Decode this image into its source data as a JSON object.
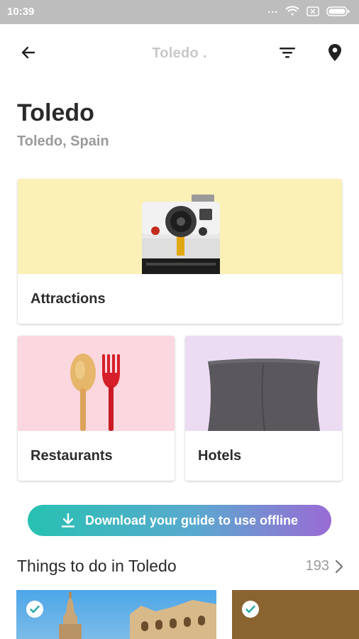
{
  "status_bar": {
    "time": "10:39",
    "dots": "..."
  },
  "header": {
    "title": "Toledo ."
  },
  "city": {
    "title": "Toledo",
    "subtitle": "Toledo, Spain"
  },
  "categories": [
    {
      "label": "Attractions"
    },
    {
      "label": "Restaurants"
    },
    {
      "label": "Hotels"
    }
  ],
  "download": {
    "label": "Download your guide to use offline"
  },
  "things_to_do": {
    "title": "Things to do in Toledo",
    "count": "193"
  },
  "colors": {
    "attractions_bg": "#fbf1b6",
    "restaurants_bg": "#fbd7df",
    "hotels_bg": "#ecdcf3",
    "gradient_start": "#27c1b2",
    "gradient_end": "#9a6bd4"
  },
  "icons": [
    "back-arrow-icon",
    "filter-icon",
    "map-pin-icon",
    "download-icon",
    "chevron-right-icon",
    "check-icon",
    "wifi-icon",
    "battery-icon"
  ]
}
